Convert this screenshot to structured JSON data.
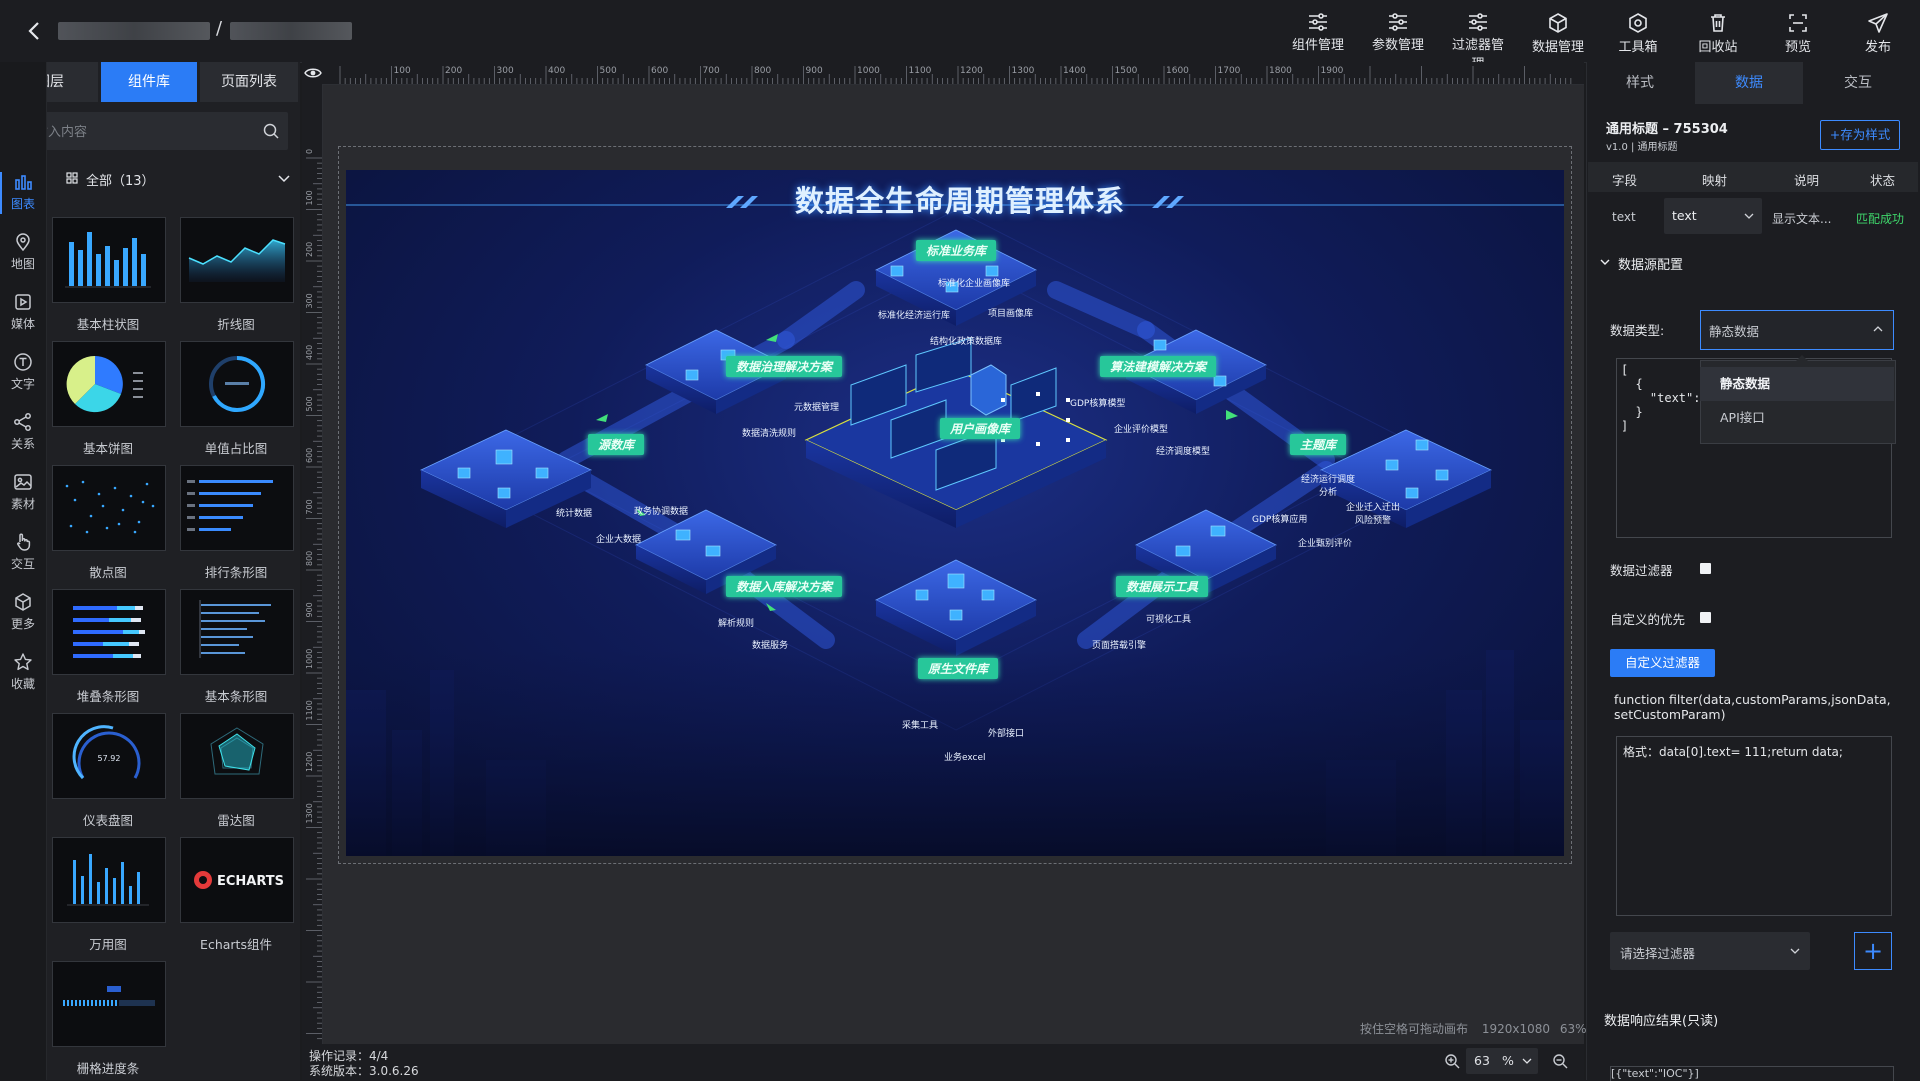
{
  "header": {
    "separator": "/",
    "tools": [
      {
        "label": "组件管理",
        "icon": "sliders-icon"
      },
      {
        "label": "参数管理",
        "icon": "sliders-icon"
      },
      {
        "label": "过滤器管理",
        "icon": "sliders-icon"
      },
      {
        "label": "数据管理",
        "icon": "cube-icon"
      },
      {
        "label": "工具箱",
        "icon": "hex-gear-icon"
      },
      {
        "label": "回收站",
        "icon": "trash-icon"
      },
      {
        "label": "预览",
        "icon": "scan-icon"
      },
      {
        "label": "发布",
        "icon": "send-icon"
      }
    ]
  },
  "left": {
    "tabs": [
      "图层",
      "组件库",
      "页面列表"
    ],
    "active_tab": "组件库",
    "search_placeholder": "请输入内容",
    "rail": [
      {
        "label": "图表",
        "icon": "chart-icon"
      },
      {
        "label": "地图",
        "icon": "map-pin-icon"
      },
      {
        "label": "媒体",
        "icon": "media-icon"
      },
      {
        "label": "文字",
        "icon": "text-icon"
      },
      {
        "label": "关系",
        "icon": "share-icon"
      },
      {
        "label": "素材",
        "icon": "image-icon"
      },
      {
        "label": "交互",
        "icon": "hand-icon"
      },
      {
        "label": "更多",
        "icon": "cube-icon"
      },
      {
        "label": "收藏",
        "icon": "star-icon"
      }
    ],
    "category": "全部（13）",
    "components": [
      "基本柱状图",
      "折线图",
      "基本饼图",
      "单值占比图",
      "散点图",
      "排行条形图",
      "堆叠条形图",
      "基本条形图",
      "仪表盘图",
      "雷达图",
      "万用图",
      "Echarts组件",
      "栅格进度条"
    ],
    "gauge_value": "57.92",
    "echarts_logo": "ECHARTS"
  },
  "canvas": {
    "title": "数据全生命周期管理体系",
    "nodes": [
      {
        "tag": "标准业务库",
        "labels": [
          "标准化企业画像库",
          "标准化经济运行库",
          "项目画像库",
          "结构化政策数据库"
        ]
      },
      {
        "tag": "数据治理解决方案",
        "labels": [
          "元数据管理",
          "数据清洗规则"
        ]
      },
      {
        "tag": "算法建模解决方案",
        "labels": [
          "GDP核算模型",
          "企业评价模型",
          "经济调度模型"
        ]
      },
      {
        "tag": "用户画像库",
        "labels": []
      },
      {
        "tag": "源数库",
        "labels": [
          "统计数据",
          "政务协调数据",
          "企业大数据"
        ]
      },
      {
        "tag": "主题库",
        "labels": [
          "经济运行调度分析",
          "企业迁入迁出风险预警",
          "GDP核算应用",
          "企业甄别评价"
        ]
      },
      {
        "tag": "数据入库解决方案",
        "labels": [
          "解析规则",
          "数据服务"
        ]
      },
      {
        "tag": "数据展示工具",
        "labels": [
          "可视化工具",
          "页面搭载引擎"
        ]
      },
      {
        "tag": "原生文件库",
        "labels": [
          "采集工具",
          "外部接口",
          "业务excel"
        ]
      }
    ],
    "hint": "按住空格可拖动画布",
    "resolution": "1920x1080",
    "zoom_pct": "63%",
    "ruler_marks": [
      "100",
      "200",
      "300",
      "400",
      "500",
      "600",
      "700",
      "800",
      "900",
      "1000",
      "1100",
      "1200",
      "1300",
      "1400",
      "1500",
      "1600",
      "1700",
      "1800",
      "1900"
    ],
    "ruler_v_marks": [
      "0",
      "100",
      "200",
      "300",
      "400",
      "500",
      "600",
      "700",
      "800",
      "900",
      "1000",
      "1100",
      "1200",
      "1300"
    ]
  },
  "status": {
    "oplog": "操作记录：4/4",
    "version": "系统版本：3.0.6.26",
    "zoom_value": "63",
    "zoom_unit": "%"
  },
  "right": {
    "tabs": [
      "样式",
      "数据",
      "交互"
    ],
    "active_tab": "数据",
    "component_title": "通用标题 – 755304",
    "component_sub": "v1.0 | 通用标题",
    "save_style": "+存为样式",
    "field_headers": [
      "字段",
      "映射",
      "说明",
      "状态"
    ],
    "field_row": {
      "field": "text",
      "mapping": "text",
      "desc": "显示文本...",
      "status": "匹配成功"
    },
    "datasource_header": "数据源配置",
    "data_type_label": "数据类型:",
    "data_type_value": "静态数据",
    "data_type_options": [
      "静态数据",
      "API接口"
    ],
    "json_text": "[\n  {\n    \"text\": \"IOC\n  }\n]",
    "data_filter_label": "数据过滤器",
    "custom_priority_label": "自定义的优先",
    "custom_filter_btn": "自定义过滤器",
    "filter_signature": "function filter(data,customParams,jsonData,setCustomParam)",
    "filter_code": "格式：data[0].text= 111;return data;",
    "filter_select_placeholder": "请选择过滤器",
    "add_filter": "+",
    "result_label": "数据响应结果(只读)",
    "result_preview": "[{\"text\":\"IOC\"}]"
  }
}
